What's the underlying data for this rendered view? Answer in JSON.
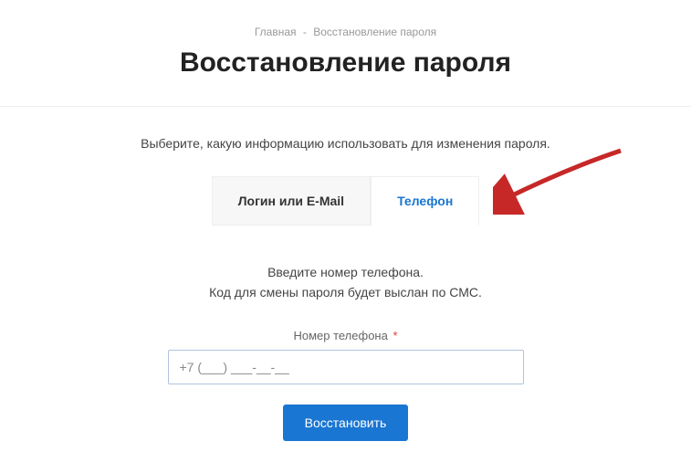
{
  "breadcrumb": {
    "home": "Главная",
    "sep": "-",
    "current": "Восстановление пароля"
  },
  "page_title": "Восстановление пароля",
  "instruction": "Выберите, какую информацию использовать для изменения пароля.",
  "tabs": {
    "login_email": "Логин или E-Mail",
    "phone": "Телефон"
  },
  "form": {
    "line1": "Введите номер телефона.",
    "line2": "Код для смены пароля будет выслан по СМС.",
    "phone_label": "Номер телефона",
    "required_mark": "*",
    "phone_value": "+7 (___) ___-__-__",
    "submit": "Восстановить"
  },
  "colors": {
    "accent": "#1976d2",
    "arrow": "#c62828"
  }
}
